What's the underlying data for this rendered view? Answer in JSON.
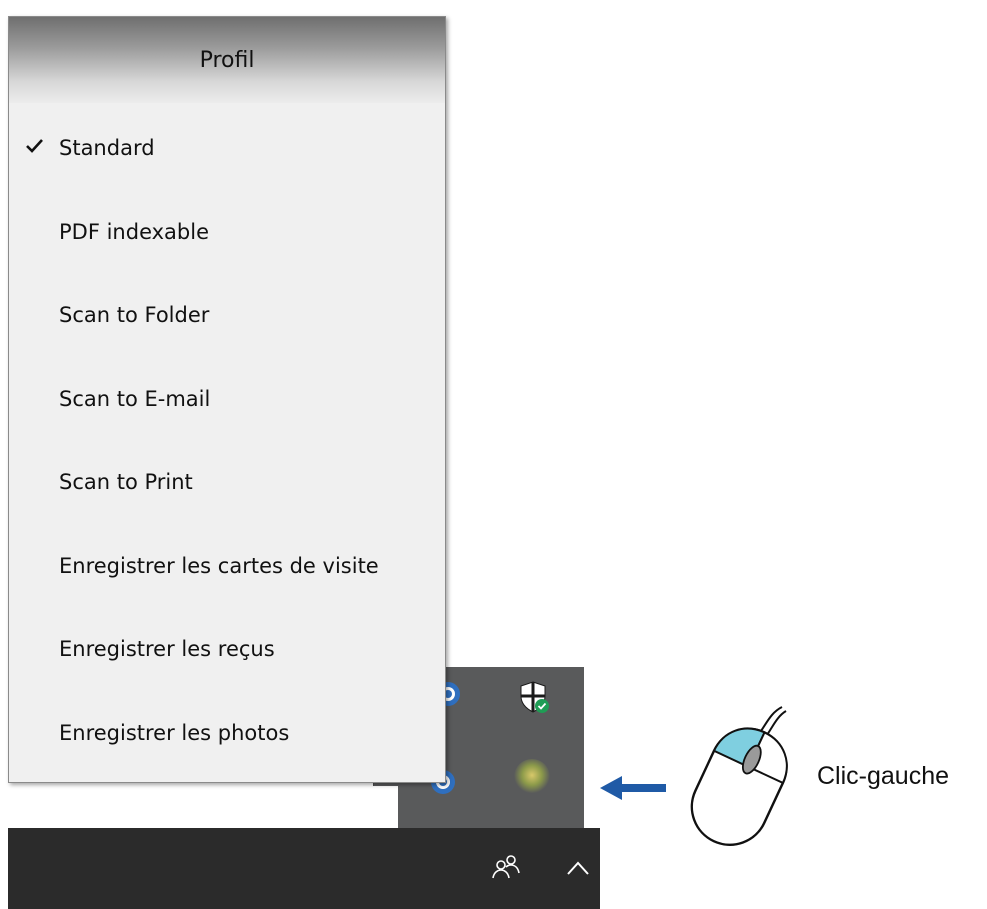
{
  "menu": {
    "header": "Profil",
    "items": [
      {
        "label": "Standard",
        "checked": true
      },
      {
        "label": "PDF indexable",
        "checked": false
      },
      {
        "label": "Scan to Folder",
        "checked": false
      },
      {
        "label": "Scan to E-mail",
        "checked": false
      },
      {
        "label": "Scan to Print",
        "checked": false
      },
      {
        "label": "Enregistrer les cartes de visite",
        "checked": false
      },
      {
        "label": "Enregistrer les reçus",
        "checked": false
      },
      {
        "label": "Enregistrer les photos",
        "checked": false
      }
    ]
  },
  "annotation": {
    "caption": "Clic-gauche",
    "arrow_color": "#1f5aa6",
    "mouse_button_color": "#7fcfe0"
  },
  "tray": {
    "icons": [
      "scanner-app-icon",
      "windows-security-icon",
      "scanner-app-icon",
      "blurred-app-icon"
    ]
  },
  "taskbar": {
    "icons": [
      "people-icon",
      "show-hidden-icons-chevron"
    ]
  }
}
